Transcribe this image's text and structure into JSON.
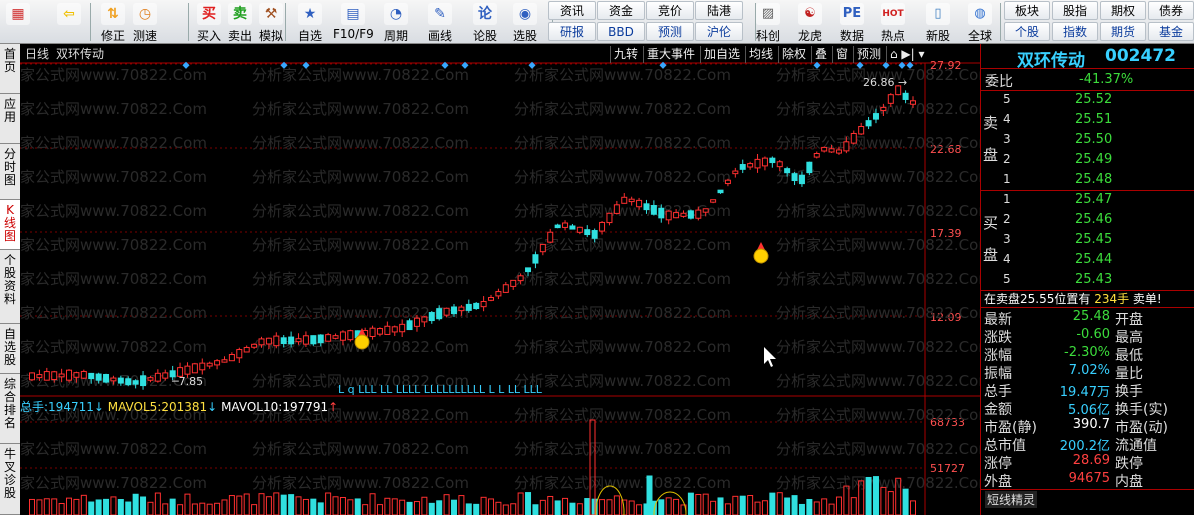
{
  "toolbar": {
    "buttons": [
      {
        "label": "",
        "icon": "home-grid-icon"
      },
      {
        "label": "",
        "icon": "back-arrow-icon"
      },
      {
        "label": "修正",
        "icon": "up-down-icon"
      },
      {
        "label": "测速",
        "icon": "clock-icon"
      },
      {
        "label": "买入",
        "icon": "buy-icon",
        "glyph": "买"
      },
      {
        "label": "卖出",
        "icon": "sell-icon",
        "glyph": "卖"
      },
      {
        "label": "模拟",
        "icon": "gavel-icon"
      },
      {
        "label": "自选",
        "icon": "star-icon"
      },
      {
        "label": "F10/F9",
        "icon": "f10-icon"
      },
      {
        "label": "周期",
        "icon": "cycle-icon"
      },
      {
        "label": "画线",
        "icon": "pencil-icon"
      },
      {
        "label": "论股",
        "icon": "chat-icon",
        "glyph": "论"
      },
      {
        "label": "选股",
        "icon": "select-icon"
      }
    ],
    "text_tabs_row1": [
      "资讯",
      "资金",
      "竞价",
      "陆港"
    ],
    "text_tabs_row2": [
      "研报",
      "BBD",
      "预测",
      "沪伦"
    ],
    "buttons2": [
      {
        "label": "科创",
        "icon": "chart-icon"
      },
      {
        "label": "龙虎",
        "icon": "dragon-icon"
      },
      {
        "label": "数据",
        "icon": "pe-icon",
        "glyph": "PE"
      },
      {
        "label": "热点",
        "icon": "hot-icon",
        "glyph": "HOT"
      },
      {
        "label": "新股",
        "icon": "ipo-icon"
      },
      {
        "label": "全球",
        "icon": "globe-icon"
      }
    ],
    "right_row1": [
      "板块",
      "股指",
      "期权",
      "债券"
    ],
    "right_row2": [
      "个股",
      "指数",
      "期货",
      "基金"
    ]
  },
  "side_tabs": [
    "首页",
    "应用",
    "分时图",
    "K线图",
    "个股资料",
    "自选股",
    "综合排名",
    "牛叉诊股"
  ],
  "chart": {
    "period": "日线",
    "stock_name": "双环传动",
    "header_tabs": [
      "九转",
      "重大事件",
      "加自选",
      "均线",
      "除权",
      "叠",
      "窗",
      "预测"
    ],
    "price_ticks": [
      "27.92",
      "22.68",
      "17.39",
      "12.09"
    ],
    "high_label": "26.86",
    "low_label": "7.85",
    "watermark": "分析家公式网www.70822.Com",
    "volume_bar": {
      "label": "总手:",
      "value": "194711",
      "mavol5_label": "MAVOL5:",
      "mavol5": "201381",
      "mavol10_label": "MAVOL10:",
      "mavol10": "197791",
      "arrow_down": "↓",
      "arrow_up": "↑"
    },
    "volume_ticks": [
      "68733",
      "51727"
    ],
    "signal_letters": "L   q LLL  LL   LLLL  LLLLLLLLLL  L  L   LL  LLL",
    "colors": {
      "up": "#ff3030",
      "down": "#30e0e0",
      "grid": "#7a0000",
      "flat": "#ffffff"
    }
  },
  "quote": {
    "title": "双环传动",
    "code": "002472",
    "weibi_label": "委比",
    "weibi": "-41.37%",
    "sell_label_1": "卖",
    "sell_label_2": "盘",
    "buy_label_1": "买",
    "buy_label_2": "盘",
    "sells": [
      {
        "n": "5",
        "p": "25.52"
      },
      {
        "n": "4",
        "p": "25.51"
      },
      {
        "n": "3",
        "p": "25.50"
      },
      {
        "n": "2",
        "p": "25.49"
      },
      {
        "n": "1",
        "p": "25.48"
      }
    ],
    "buys": [
      {
        "n": "1",
        "p": "25.47"
      },
      {
        "n": "2",
        "p": "25.46"
      },
      {
        "n": "3",
        "p": "25.45"
      },
      {
        "n": "4",
        "p": "25.44"
      },
      {
        "n": "5",
        "p": "25.43"
      }
    ],
    "notice": "在卖盘25.55位置有",
    "notice_qty": "234手",
    "notice_tail": "卖单!",
    "stats": [
      {
        "l": "最新",
        "v": "25.48",
        "c": "grn",
        "r": "开盘"
      },
      {
        "l": "涨跌",
        "v": "-0.60",
        "c": "grn",
        "r": "最高"
      },
      {
        "l": "涨幅",
        "v": "-2.30%",
        "c": "grn",
        "r": "最低"
      },
      {
        "l": "振幅",
        "v": "7.02%",
        "c": "cyn",
        "r": "量比"
      },
      {
        "l": "总手",
        "v": "19.47万",
        "c": "cyn",
        "r": "换手"
      },
      {
        "l": "金额",
        "v": "5.06亿",
        "c": "cyn",
        "r": "换手(实)"
      },
      {
        "l": "市盈(静)",
        "v": "390.7",
        "c": "wht",
        "r": "市盈(动)"
      },
      {
        "l": "总市值",
        "v": "200.2亿",
        "c": "cyn",
        "r": "流通值"
      },
      {
        "l": "涨停",
        "v": "28.69",
        "c": "red",
        "r": "跌停"
      },
      {
        "l": "外盘",
        "v": "94675",
        "c": "red",
        "r": "内盘"
      }
    ],
    "footer": "短线精灵"
  }
}
